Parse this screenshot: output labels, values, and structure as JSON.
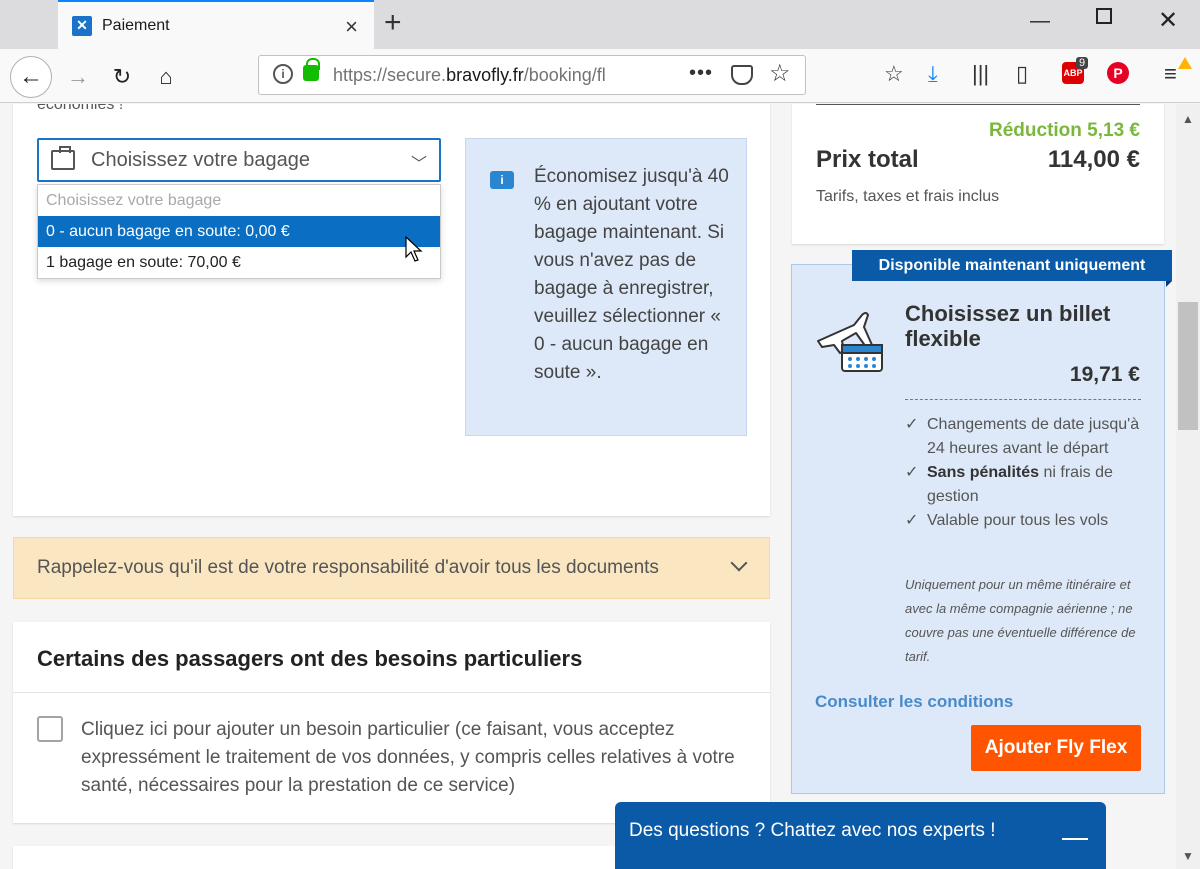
{
  "browser": {
    "tab_title": "Paiement",
    "url_prefix": "https://secure.",
    "url_domain": "bravofly.fr",
    "url_suffix": "/booking/fl",
    "adblock_count": "9",
    "adblock_label": "ABP",
    "pinterest_label": "P"
  },
  "baggage": {
    "savings_text": "économies !",
    "select_placeholder": "Choisissez votre bagage",
    "options": [
      "Choisissez votre bagage",
      "0 - aucun bagage en soute: 0,00 €",
      "1 bagage en soute: 70,00 €"
    ],
    "info_icon": "i",
    "info_text": "Économisez jusqu'à 40 % en ajoutant votre bagage maintenant. Si vous n'avez pas de bagage à enregistrer, veuillez sélectionner « 0 - aucun bagage en soute »."
  },
  "reminder": {
    "text": "Rappelez-vous qu'il est de votre responsabilité d'avoir tous les documents"
  },
  "special_needs": {
    "title": "Certains des passagers ont des besoins particuliers",
    "checkbox_text": "Cliquez ici pour ajouter un besoin particulier (ce faisant, vous acceptez expressément le traitement de vos données, y compris celles relatives à votre santé, nécessaires pour la prestation de ce service)"
  },
  "summary": {
    "reduction": "Réduction 5,13 €",
    "total_label": "Prix total",
    "total_value": "114,00 €",
    "note": "Tarifs, taxes et frais inclus"
  },
  "flex": {
    "banner": "Disponible maintenant uniquement",
    "title": "Choisissez un billet flexible",
    "price": "19,71 €",
    "features": [
      {
        "pre": "Changements de date jusqu'à 24 heures avant le départ",
        "bold": "",
        "post": ""
      },
      {
        "pre": "",
        "bold": "Sans pénalités",
        "post": " ni frais de gestion"
      },
      {
        "pre": "Valable pour tous les vols",
        "bold": "",
        "post": ""
      }
    ],
    "disclaimer": "Uniquement pour un même itinéraire et avec la même compagnie aérienne ; ne couvre pas une éventuelle différence de tarif.",
    "conditions_link": "Consulter les conditions",
    "add_button": "Ajouter Fly Flex"
  },
  "chat": {
    "text": "Des questions ? Chattez avec nos experts !"
  },
  "colors": {
    "accent": "#0a5aa8",
    "selected": "#0a6fc2",
    "cta": "#ff5500",
    "reduction": "#7ab83b",
    "reminder_bg": "#fbe6c2",
    "info_bg": "#dde9f8"
  }
}
